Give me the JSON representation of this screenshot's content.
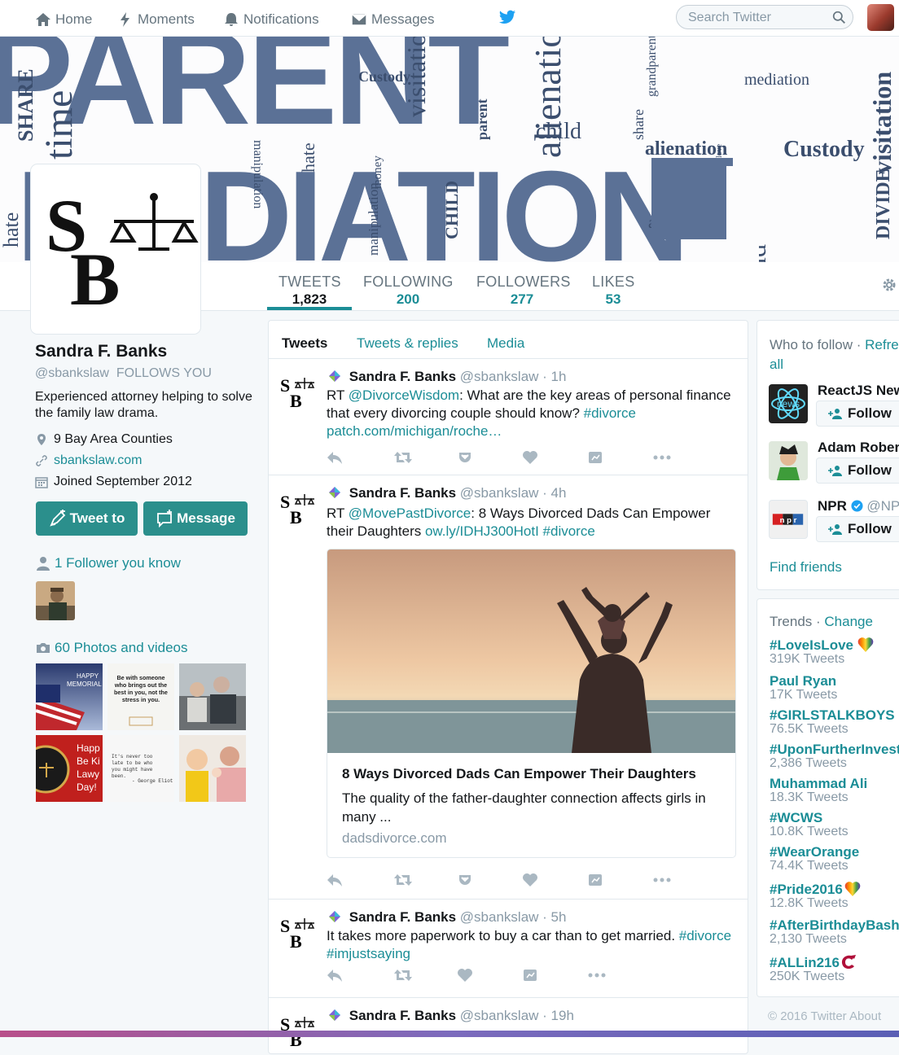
{
  "topnav": {
    "home": "Home",
    "moments": "Moments",
    "notifications": "Notifications",
    "messages": "Messages",
    "search_placeholder": "Search Twitter"
  },
  "banner": {
    "words": [
      "PARENT",
      "MEDIATION",
      "time",
      "SHARE",
      "Custody",
      "visitation",
      "alienation",
      "child",
      "parent",
      "share",
      "grandparent",
      "mediation",
      "alienation",
      "Custody",
      "manipulation",
      "hate",
      "money",
      "manipulation",
      "CHILD",
      "DIVIDE",
      "visitation",
      "alienation",
      "hate",
      "child",
      "love"
    ]
  },
  "profile": {
    "name": "Sandra F. Banks",
    "handle": "@sbankslaw",
    "follows_you": "FOLLOWS YOU",
    "bio": "Experienced attorney helping to solve the family law drama.",
    "location": "9 Bay Area Counties",
    "website": "sbankslaw.com",
    "joined": "Joined September 2012",
    "tweet_to_label": "Tweet to",
    "message_label": "Message",
    "followers_you_know": "1 Follower you know",
    "photos_videos": "60 Photos and videos",
    "thumb_texts": {
      "memorial": "HAPPY MEMORIAL",
      "quote": "Be with someone who brings out the best in you, not the stress in you.",
      "lawyer": "Happy Be Kind Lawyer Day!",
      "eliot": "It's never too late to be who you might have been. - George Eliot"
    }
  },
  "stats": [
    {
      "label": "TWEETS",
      "value": "1,823"
    },
    {
      "label": "FOLLOWING",
      "value": "200"
    },
    {
      "label": "FOLLOWERS",
      "value": "277"
    },
    {
      "label": "LIKES",
      "value": "53"
    }
  ],
  "timeline": {
    "tabs": [
      "Tweets",
      "Tweets & replies",
      "Media"
    ],
    "tweets": [
      {
        "name": "Sandra F. Banks",
        "handle": "@sbankslaw · 1h",
        "text_parts": [
          "RT ",
          "@DivorceWisdom",
          ": What are the key areas of personal finance that every divorcing couple should know?  ",
          "#divorce",
          " ",
          "patch.com/michigan/roche…"
        ]
      },
      {
        "name": "Sandra F. Banks",
        "handle": "@sbankslaw · 4h",
        "text_parts": [
          "RT ",
          "@MovePastDivorce",
          ": 8 Ways Divorced Dads Can Empower their Daughters ",
          "ow.ly/IDHJ300HotI",
          " ",
          "#divorce"
        ],
        "card": {
          "title": "8 Ways Divorced Dads Can Empower Their Daughters",
          "description": "The quality of the father-daughter connection affects girls in many ...",
          "url": "dadsdivorce.com"
        }
      },
      {
        "name": "Sandra F. Banks",
        "handle": "@sbankslaw · 5h",
        "text_parts": [
          "It takes more paperwork to buy a car than to get married. ",
          "#divorce",
          " ",
          "#imjustsaying"
        ]
      },
      {
        "name": "Sandra F. Banks",
        "handle": "@sbankslaw · 19h"
      }
    ]
  },
  "who_to_follow": {
    "title": "Who to follow · ",
    "refresh": "Refresh",
    "view_all": "all",
    "users": [
      {
        "name": "ReactJS News",
        "handle": "",
        "avatar_text": "news"
      },
      {
        "name": "Adam Roberts",
        "handle": ""
      },
      {
        "name": "NPR",
        "handle": "@NPR",
        "avatar_text": "n p r"
      }
    ],
    "follow_label": "Follow",
    "find_friends": "Find friends"
  },
  "trends": {
    "title": "Trends · ",
    "change": "Change",
    "items": [
      {
        "name": "#LoveIsLove",
        "count": "319K Tweets"
      },
      {
        "name": "Paul Ryan",
        "count": "17K Tweets"
      },
      {
        "name": "#GIRLSTALKBOYS",
        "count": "76.5K Tweets"
      },
      {
        "name": "#UponFurtherInvestigation",
        "count": "2,386 Tweets"
      },
      {
        "name": "Muhammad Ali",
        "count": "18.3K Tweets"
      },
      {
        "name": "#WCWS",
        "count": "10.8K Tweets"
      },
      {
        "name": "#WearOrange",
        "count": "74.4K Tweets"
      },
      {
        "name": "#Pride2016",
        "count": "12.8K Tweets"
      },
      {
        "name": "#AfterBirthdayBash",
        "count": "2,130 Tweets"
      },
      {
        "name": "#ALLin216",
        "count": "250K Tweets"
      }
    ]
  },
  "footer": "© 2016 Twitter  About",
  "colors": {
    "accent": "#1b8d96",
    "button": "#2b8f8c",
    "banner_blue": "#5b7196"
  }
}
